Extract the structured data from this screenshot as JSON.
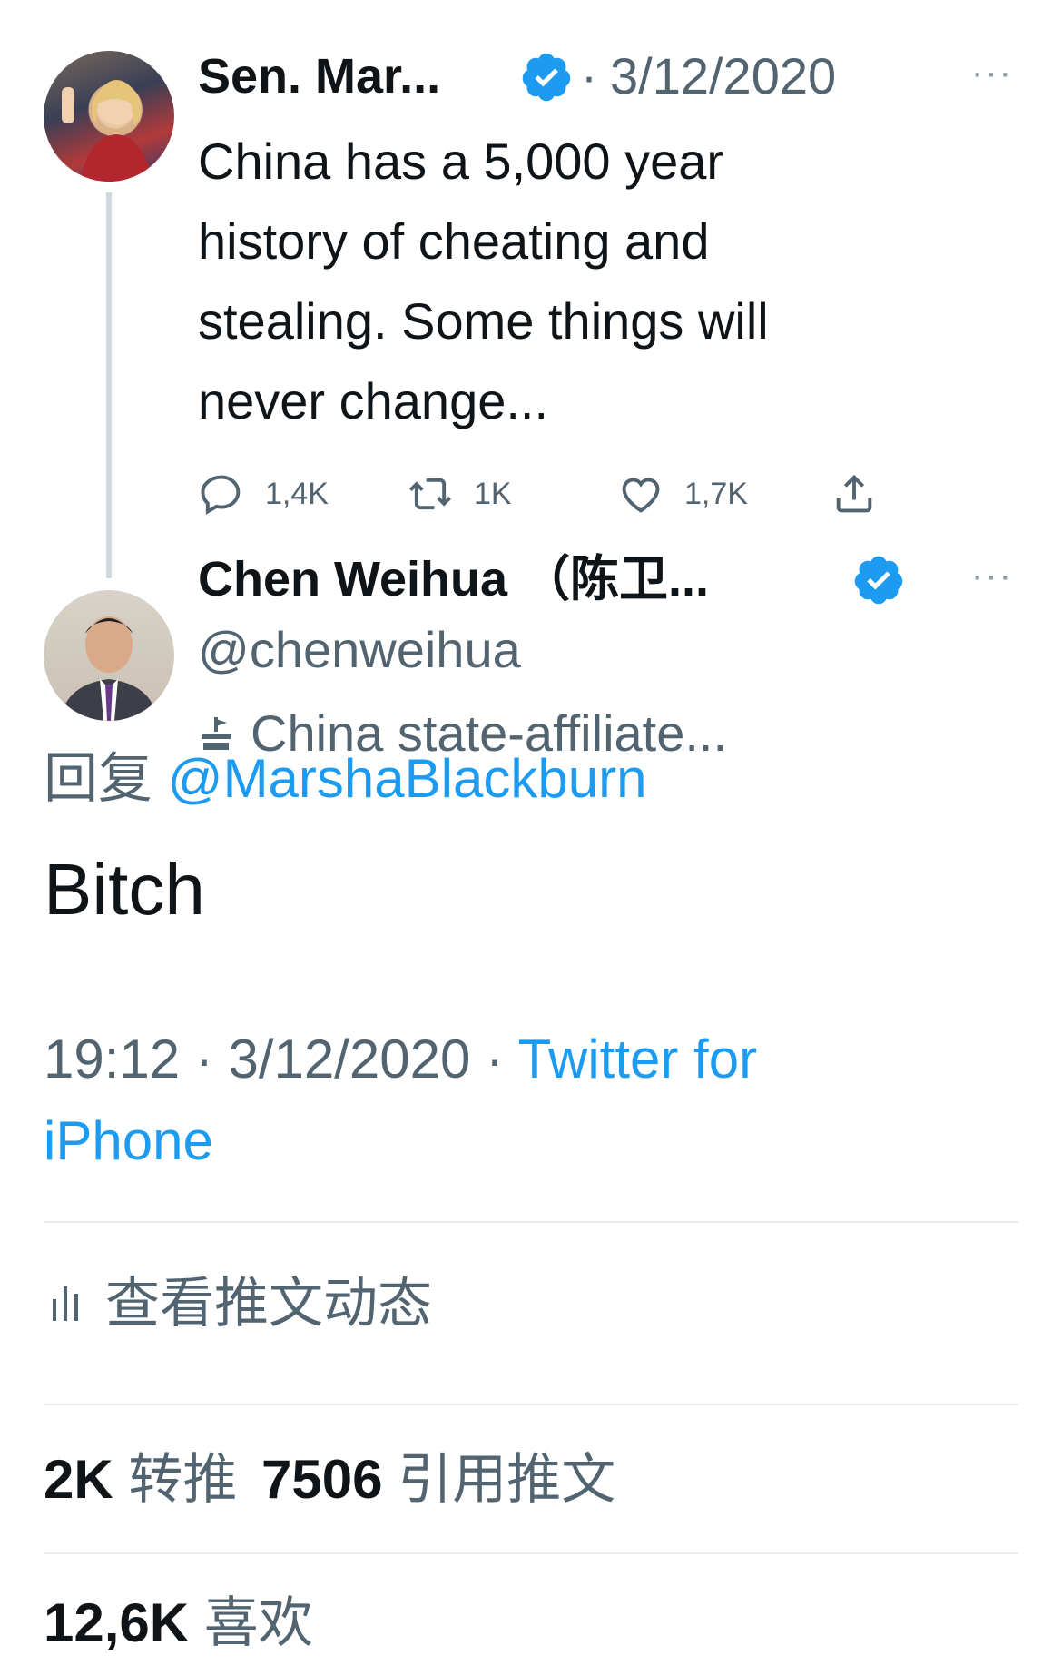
{
  "parent_tweet": {
    "author_name": "Sen. Mar...",
    "date": "3/12/2020",
    "separator": "·",
    "text_lines": [
      "China has a 5,000 year",
      "history of cheating and",
      "stealing. Some things will",
      "never change..."
    ],
    "replies": "1,4K",
    "retweets": "1K",
    "likes": "1,7K",
    "more": "···"
  },
  "reply_tweet": {
    "author_name": "Chen Weihua （陈卫...",
    "handle": "@chenweihua",
    "label": "China state-affiliate...",
    "reply_prefix": "回复",
    "reply_to": "@MarshaBlackburn",
    "text": "Bitch",
    "time": "19:12",
    "sep": "·",
    "date": "3/12/2020",
    "source_line1": "Twitter for",
    "source_line2": "iPhone",
    "more": "···"
  },
  "activity": {
    "label": "查看推文动态"
  },
  "stats": {
    "retweets_count": "2K",
    "retweets_label": "转推",
    "quotes_count": "7506",
    "quotes_label": "引用推文",
    "likes_count": "12,6K",
    "likes_label": "喜欢"
  },
  "colors": {
    "verified": "#1d9bf0",
    "link": "#1d9bf0",
    "muted": "#536471"
  }
}
